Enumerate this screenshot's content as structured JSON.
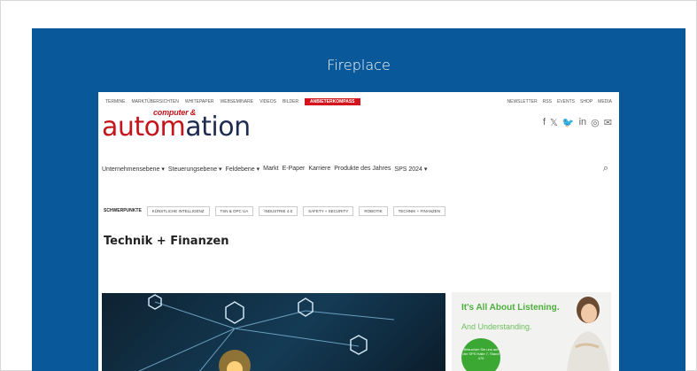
{
  "fireplace": {
    "label": "Fireplace"
  },
  "topnav": {
    "left_items": [
      "TERMINE",
      "MARKTÜBERSICHTEN",
      "WHITEPAPER",
      "WEBSEMINARE",
      "VIDEOS",
      "BILDER"
    ],
    "highlight": "ANBIETERKOMPASS",
    "right_items": [
      "NEWSLETTER",
      "RSS",
      "EVENTS",
      "SHOP",
      "MEDIA"
    ]
  },
  "logo": {
    "small": "computer &",
    "big_a": "autom",
    "big_b": "ation"
  },
  "social_icons": [
    "facebook-icon",
    "x-icon",
    "twitter-icon",
    "linkedin-icon",
    "instagram-icon",
    "mail-icon"
  ],
  "mainnav": {
    "items": [
      "Unternehmensebene",
      "Steuerungsebene",
      "Feldebene",
      "Markt",
      "E-Paper",
      "Karriere",
      "Produkte des Jahres",
      "SPS 2024"
    ],
    "dropdowns": [
      true,
      true,
      true,
      false,
      false,
      false,
      false,
      true
    ]
  },
  "focus": {
    "label": "SCHWERPUNKTE",
    "tags": [
      "KÜNSTLICHE INTELLIGENZ",
      "TSN & OPC UA",
      "INDUSTRIE 4.0",
      "SAFETY + SECURITY",
      "ROBOTIK",
      "TECHNIK + FINANZEN"
    ]
  },
  "page": {
    "title": "Technik + Finanzen"
  },
  "ad": {
    "headline": "It's All About Listening.",
    "subline": "And Understanding.",
    "bubble": "Besuchen Sie uns auf der SPS Halle 7, Stand 470"
  }
}
